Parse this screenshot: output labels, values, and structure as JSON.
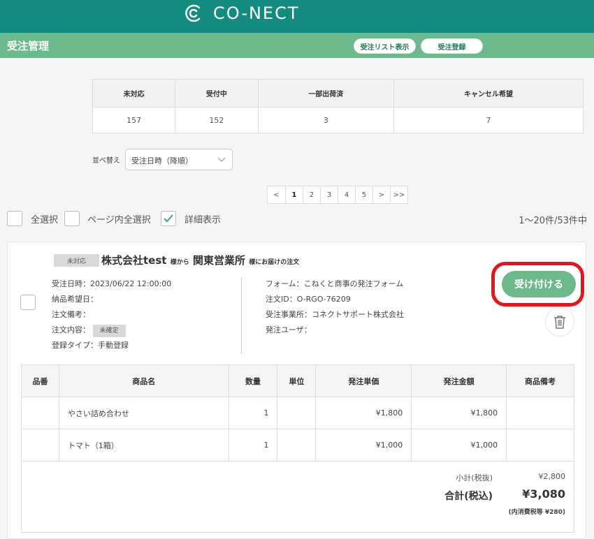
{
  "app": {
    "logo_text": "CO-NECT"
  },
  "header": {
    "title": "受注管理",
    "list_button": "受注リスト表示",
    "register_button": "受注登録"
  },
  "stats": {
    "headers": [
      "未対応",
      "受付中",
      "一部出荷済",
      "キャンセル希望"
    ],
    "values": [
      "157",
      "152",
      "3",
      "7"
    ]
  },
  "sort": {
    "label": "並べ替え",
    "value": "受注日時（降順）"
  },
  "pagination": {
    "pages": [
      "<",
      "1",
      "2",
      "3",
      "4",
      "5",
      ">",
      ">>"
    ],
    "current": "1"
  },
  "options": {
    "select_all": "全選択",
    "select_page": "ページ内全選択",
    "detail_view": "詳細表示",
    "detail_checked": true
  },
  "result_count": "1〜20件/53件中",
  "order": {
    "status": "未対応",
    "company": "株式会社test",
    "from_suffix": "様から",
    "office": "関東営業所",
    "to_suffix": "様にお届けの注文",
    "order_date": "受注日時：2023/06/22 12:00:00",
    "delivery_date": "納品希望日：",
    "note": "注文備考：",
    "content_label": "注文内容：",
    "content_badge": "未確定",
    "register_type": "登録タイプ：手動登録",
    "form": "フォーム：こねくと商事の発注フォーム",
    "order_id": "注文ID：O-RGO-76209",
    "office_line": "受注事業所：コネクトサポート株式会社",
    "ordering_user": "発注ユーザ：",
    "accept_button": "受け付ける",
    "accent_color": "#6cb98b",
    "highlight_color": "#e8141d"
  },
  "items": {
    "headers": [
      "品番",
      "商品名",
      "数量",
      "単位",
      "発注単価",
      "発注金額",
      "商品備考"
    ],
    "rows": [
      [
        "",
        "やさい詰め合わせ",
        "1",
        "",
        "¥1,800",
        "¥1,800",
        ""
      ],
      [
        "",
        "トマト（1箱）",
        "1",
        "",
        "¥1,000",
        "¥1,000",
        ""
      ]
    ]
  },
  "totals": {
    "subtotal_label": "小計(税抜)",
    "subtotal_value": "¥2,800",
    "total_label": "合計(税込)",
    "total_value": "¥3,080",
    "tax_note": "(内消費税等 ¥280)"
  }
}
